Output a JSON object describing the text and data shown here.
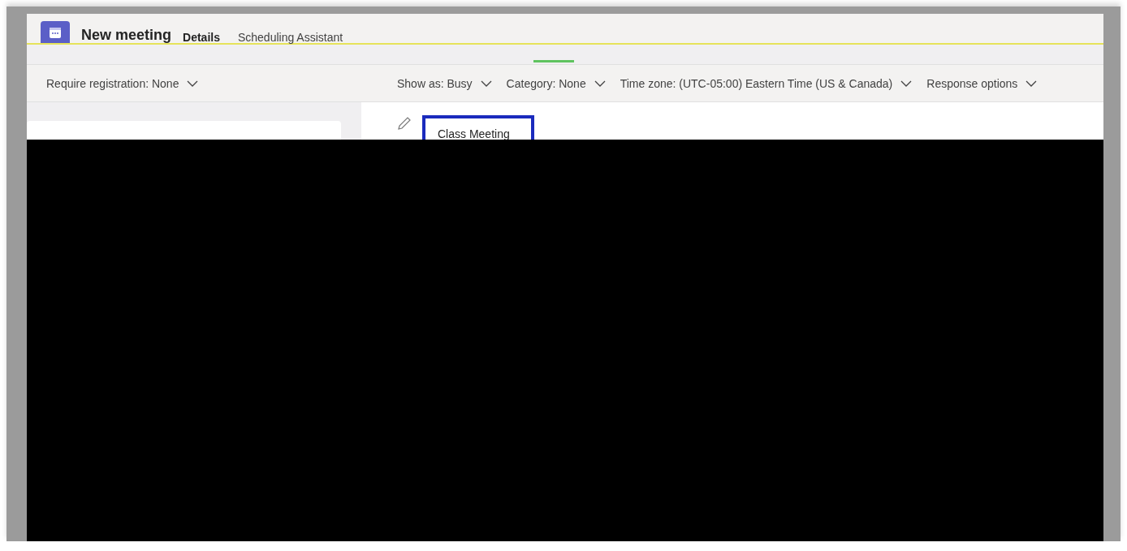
{
  "window": {
    "title": "New meeting"
  },
  "tabs": [
    {
      "label": "Details",
      "selected": true
    },
    {
      "label": "Scheduling Assistant",
      "selected": false
    }
  ],
  "toolbar": {
    "left": [
      {
        "label": "Require registration: None"
      }
    ],
    "right": [
      {
        "label": "Show as: Busy"
      },
      {
        "label": "Category: None"
      },
      {
        "label": "Time zone: (UTC-05:00) Eastern Time (US & Canada)"
      },
      {
        "label": "Response options"
      }
    ]
  },
  "title_field": {
    "value": "Class Meeting"
  }
}
